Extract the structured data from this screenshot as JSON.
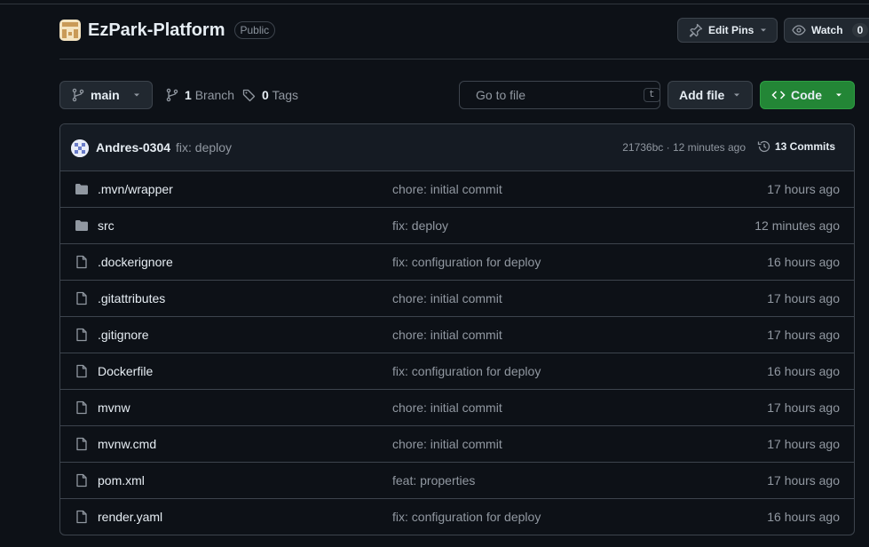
{
  "repo": {
    "name": "EzPark-Platform",
    "visibility": "Public"
  },
  "actions": {
    "edit_pins": "Edit Pins",
    "watch": "Watch",
    "watch_count": "0"
  },
  "toolbar": {
    "branch": "main",
    "branch_count": "1",
    "branch_label": "Branch",
    "tag_count": "0",
    "tag_label": "Tags",
    "search_placeholder": "Go to file",
    "search_shortcut": "t",
    "add_file": "Add file",
    "code": "Code"
  },
  "commit": {
    "author": "Andres-0304",
    "message": "fix: deploy",
    "hash_time": "21736bc · 12 minutes ago",
    "commits_count": "13",
    "commits_label": "Commits"
  },
  "files": [
    {
      "icon": "folder-icon",
      "name": ".mvn/wrapper",
      "message": "chore: initial commit",
      "time": "17 hours ago"
    },
    {
      "icon": "folder-icon",
      "name": "src",
      "message": "fix: deploy",
      "time": "12 minutes ago"
    },
    {
      "icon": "file-icon",
      "name": ".dockerignore",
      "message": "fix: configuration for deploy",
      "time": "16 hours ago"
    },
    {
      "icon": "file-icon",
      "name": ".gitattributes",
      "message": "chore: initial commit",
      "time": "17 hours ago"
    },
    {
      "icon": "file-icon",
      "name": ".gitignore",
      "message": "chore: initial commit",
      "time": "17 hours ago"
    },
    {
      "icon": "file-icon",
      "name": "Dockerfile",
      "message": "fix: configuration for deploy",
      "time": "16 hours ago"
    },
    {
      "icon": "file-icon",
      "name": "mvnw",
      "message": "chore: initial commit",
      "time": "17 hours ago"
    },
    {
      "icon": "file-icon",
      "name": "mvnw.cmd",
      "message": "chore: initial commit",
      "time": "17 hours ago"
    },
    {
      "icon": "file-icon",
      "name": "pom.xml",
      "message": "feat: properties",
      "time": "17 hours ago"
    },
    {
      "icon": "file-icon",
      "name": "render.yaml",
      "message": "fix: configuration for deploy",
      "time": "16 hours ago"
    }
  ],
  "colors": {
    "background": "#0d1117",
    "border": "#3d444d",
    "code_button": "#238636",
    "muted_text": "#9198a1"
  }
}
